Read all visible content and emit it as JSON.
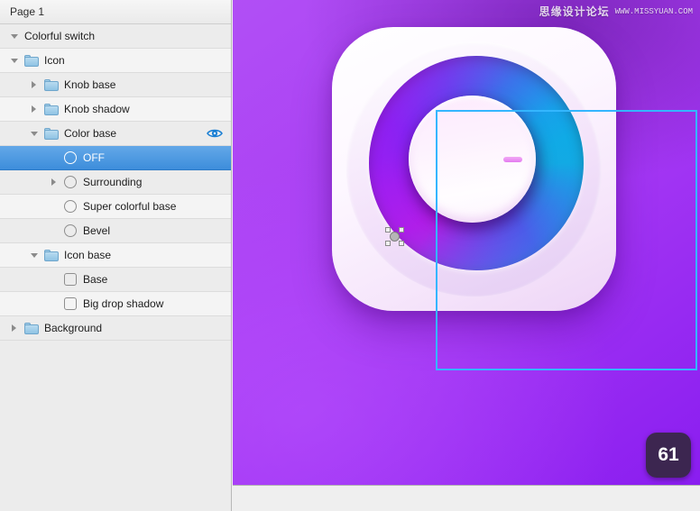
{
  "sidebar": {
    "page_header": "Page 1",
    "layers": [
      {
        "label": "Colorful switch",
        "indent": 0,
        "icon": "none",
        "disclosure": "open",
        "selected": false,
        "visible": false
      },
      {
        "label": "Icon",
        "indent": 0,
        "icon": "folder",
        "disclosure": "open",
        "selected": false,
        "visible": false
      },
      {
        "label": "Knob base",
        "indent": 1,
        "icon": "folder",
        "disclosure": "closed",
        "selected": false,
        "visible": false
      },
      {
        "label": "Knob shadow",
        "indent": 1,
        "icon": "folder",
        "disclosure": "closed",
        "selected": false,
        "visible": false
      },
      {
        "label": "Color base",
        "indent": 1,
        "icon": "folder",
        "disclosure": "open",
        "selected": false,
        "visible": true
      },
      {
        "label": "OFF",
        "indent": 2,
        "icon": "circle",
        "disclosure": "none",
        "selected": true,
        "visible": false
      },
      {
        "label": "Surrounding",
        "indent": 2,
        "icon": "circle",
        "disclosure": "closed",
        "selected": false,
        "visible": false
      },
      {
        "label": "Super colorful base",
        "indent": 2,
        "icon": "circle",
        "disclosure": "none",
        "selected": false,
        "visible": false
      },
      {
        "label": "Bevel",
        "indent": 2,
        "icon": "circle",
        "disclosure": "none",
        "selected": false,
        "visible": false
      },
      {
        "label": "Icon base",
        "indent": 1,
        "icon": "folder",
        "disclosure": "open",
        "selected": false,
        "visible": false
      },
      {
        "label": "Base",
        "indent": 2,
        "icon": "square",
        "disclosure": "none",
        "selected": false,
        "visible": false
      },
      {
        "label": "Big drop shadow",
        "indent": 2,
        "icon": "square",
        "disclosure": "none",
        "selected": false,
        "visible": false
      },
      {
        "label": "Background",
        "indent": 0,
        "icon": "folder",
        "disclosure": "closed",
        "selected": false,
        "visible": false
      }
    ]
  },
  "canvas": {
    "background_color": "#a93cf4",
    "watermark_cn": "思缘设计论坛",
    "watermark_url": "WWW.MISSYUAN.COM",
    "badge": "61",
    "artwork": {
      "name": "colorful-switch-icon",
      "ring_colors": [
        "#c612e6",
        "#7b2bf5",
        "#1f8fe8",
        "#06b6e8"
      ],
      "knob_color": "#fdf2fe",
      "knob_dash_color": "#e37bf0",
      "selection_color": "#34b6ff"
    }
  }
}
